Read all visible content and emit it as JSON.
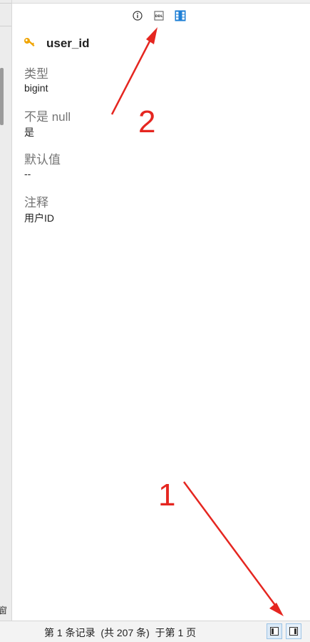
{
  "toolbar": {
    "icons": [
      "info-icon",
      "ddl-icon",
      "columns-icon"
    ],
    "ddl_label": "DDL"
  },
  "field": {
    "icon": "key-icon",
    "name": "user_id"
  },
  "properties": [
    {
      "label": "类型",
      "value": "bigint"
    },
    {
      "label": "不是 null",
      "value": "是"
    },
    {
      "label": "默认值",
      "value": "--"
    },
    {
      "label": "注释",
      "value": "用户ID"
    }
  ],
  "left_edge_char": "窗",
  "statusbar": {
    "text_part1": "第 1 条记录  (共 207 条)  于第 1 页",
    "buttons": [
      "panel-left-icon",
      "panel-right-icon"
    ]
  },
  "annotations": {
    "label_1": "1",
    "label_2": "2",
    "color": "#e52620"
  },
  "colors": {
    "key_icon": "#f0a400",
    "columns_icon": "#1e7fd6",
    "label_gray": "#757575"
  }
}
